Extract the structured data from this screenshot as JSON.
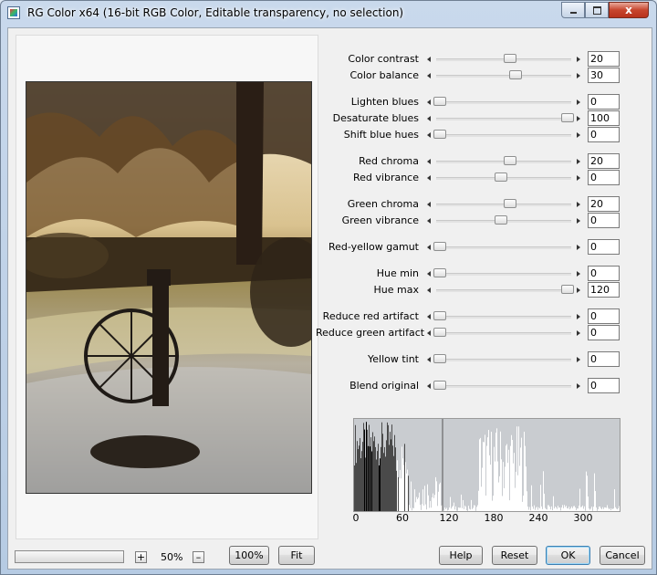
{
  "window": {
    "title": "RG Color x64 (16-bit RGB Color, Editable transparency, no selection)",
    "close_glyph": "x"
  },
  "controls": [
    {
      "label": "Color contrast",
      "value": "20"
    },
    {
      "label": "Color balance",
      "value": "30"
    },
    {
      "label": "Lighten blues",
      "value": "0"
    },
    {
      "label": "Desaturate blues",
      "value": "100"
    },
    {
      "label": "Shift blue hues",
      "value": "0"
    },
    {
      "label": "Red chroma",
      "value": "20"
    },
    {
      "label": "Red vibrance",
      "value": "0"
    },
    {
      "label": "Green chroma",
      "value": "20"
    },
    {
      "label": "Green vibrance",
      "value": "0"
    },
    {
      "label": "Red-yellow gamut",
      "value": "0"
    },
    {
      "label": "Hue min",
      "value": "0"
    },
    {
      "label": "Hue max",
      "value": "120"
    },
    {
      "label": "Reduce red artifact",
      "value": "0"
    },
    {
      "label": "Reduce green artifact",
      "value": "0"
    },
    {
      "label": "Yellow tint",
      "value": "0"
    },
    {
      "label": "Blend original",
      "value": "0"
    }
  ],
  "slider_positions": [
    0.55,
    0.59,
    0.03,
    0.97,
    0.03,
    0.55,
    0.48,
    0.55,
    0.48,
    0.03,
    0.03,
    0.97,
    0.03,
    0.03,
    0.03,
    0.03
  ],
  "histogram": {
    "tick_labels": [
      "0",
      "60",
      "120",
      "180",
      "240",
      "300"
    ]
  },
  "zoom": {
    "plus": "+",
    "minus": "–",
    "value": "50%",
    "hundred_label": "100%",
    "fit_label": "Fit"
  },
  "buttons": {
    "help": "Help",
    "reset": "Reset",
    "ok": "OK",
    "cancel": "Cancel"
  },
  "colors": {
    "accent": "#3c7fb1",
    "histogram_bg": "#c9ccd0",
    "histogram_dark": "#4a4a4a",
    "histogram_light": "#ffffff"
  }
}
